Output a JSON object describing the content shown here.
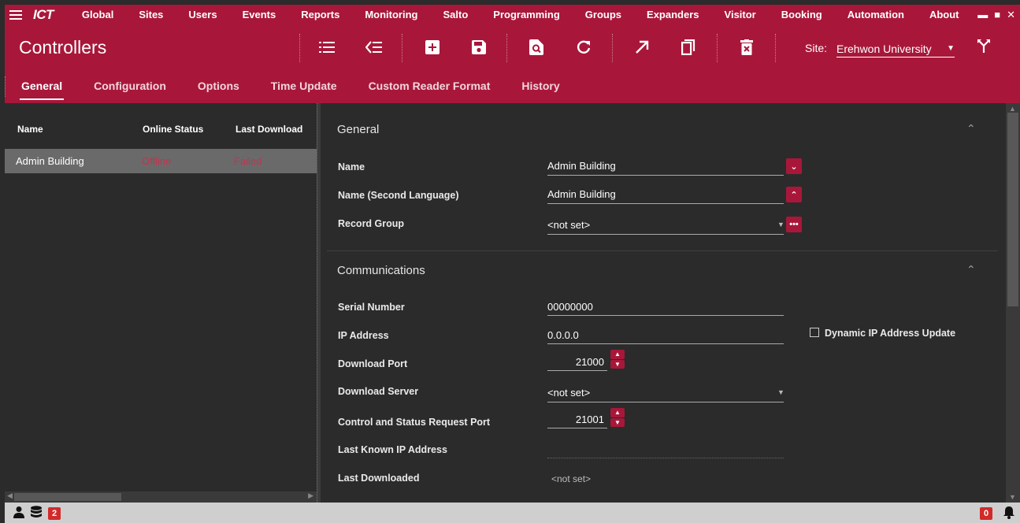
{
  "topnav": {
    "logo": "ICT",
    "items": [
      "Global",
      "Sites",
      "Users",
      "Events",
      "Reports",
      "Monitoring",
      "Salto",
      "Programming",
      "Groups",
      "Expanders",
      "Visitor",
      "Booking",
      "Automation",
      "About"
    ]
  },
  "header": {
    "title": "Controllers",
    "site_label": "Site:",
    "site_value": "Erehwon University"
  },
  "tabs": [
    "General",
    "Configuration",
    "Options",
    "Time Update",
    "Custom Reader Format",
    "History"
  ],
  "list": {
    "columns": [
      "Name",
      "Online Status",
      "Last Download"
    ],
    "rows": [
      {
        "name": "Admin Building",
        "online_status": "Offline",
        "last_download": "Failed"
      }
    ]
  },
  "general": {
    "title": "General",
    "name_label": "Name",
    "name_value": "Admin Building",
    "name2_label": "Name (Second Language)",
    "name2_value": "Admin Building",
    "record_group_label": "Record Group",
    "record_group_value": "<not set>"
  },
  "communications": {
    "title": "Communications",
    "serial_label": "Serial Number",
    "serial_value": "00000000",
    "ip_label": "IP Address",
    "ip_value": "0.0.0.0",
    "dynamic_ip_label": "Dynamic IP Address Update",
    "download_port_label": "Download Port",
    "download_port_value": "21000",
    "download_server_label": "Download Server",
    "download_server_value": "<not set>",
    "csr_port_label": "Control and Status Request Port",
    "csr_port_value": "21001",
    "last_ip_label": "Last Known IP Address",
    "last_downloaded_label": "Last Downloaded",
    "last_downloaded_value": "<not set>"
  },
  "statusbar": {
    "db_badge": "2",
    "alert_badge": "0"
  },
  "colors": {
    "accent": "#a8173a",
    "panel": "#2b2b2b",
    "selected_row": "#6a6a6a",
    "status_red": "#c0344f"
  }
}
